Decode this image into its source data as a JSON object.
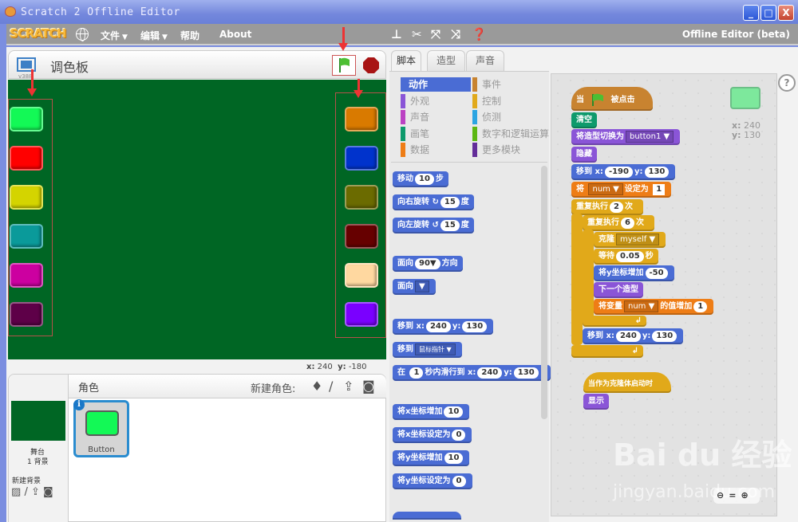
{
  "window": {
    "title": "Scratch 2 Offline Editor",
    "minimize": "_",
    "maximize": "□",
    "close": "X"
  },
  "menubar": {
    "logo": "SCRATCH",
    "items": [
      {
        "label": "文件",
        "has_dropdown": true
      },
      {
        "label": "编辑",
        "has_dropdown": true
      },
      {
        "label": "帮助"
      },
      {
        "label": "About"
      }
    ],
    "tool_icons": [
      "duplicate-stamp-icon",
      "cut-scissors-icon",
      "grow-icon",
      "shrink-icon",
      "help-icon"
    ],
    "right_label": "Offline Editor (beta)"
  },
  "stage": {
    "title": "调色板",
    "version": "v388",
    "mouse_x_label": "x:",
    "mouse_x": "240",
    "mouse_y_label": "y:",
    "mouse_y": "-180",
    "left_buttons": [
      "#13f956",
      "#ff0000",
      "#d4d400",
      "#0a9a9a",
      "#cc00a0",
      "#5e0048"
    ],
    "right_buttons": [
      "#d97a00",
      "#0033cc",
      "#6b6b00",
      "#660000",
      "#ffd8a0",
      "#7a00ff"
    ],
    "background": "#006624"
  },
  "sprites": {
    "header": "角色",
    "new_sprite_label": "新建角色:",
    "stage_label": "舞台",
    "backdrop_count": "1 背景",
    "new_backdrop_label": "新建背景",
    "items": [
      {
        "name": "Button",
        "color": "#13f956"
      }
    ]
  },
  "tabs": [
    {
      "label": "脚本",
      "active": true
    },
    {
      "label": "造型"
    },
    {
      "label": "声音"
    }
  ],
  "categories": {
    "left": [
      {
        "label": "动作",
        "color": "#4a6cd4",
        "selected": true
      },
      {
        "label": "外观",
        "color": "#8a55d7"
      },
      {
        "label": "声音",
        "color": "#bb42c3"
      },
      {
        "label": "画笔",
        "color": "#0e9a6c"
      },
      {
        "label": "数据",
        "color": "#ee7d16"
      }
    ],
    "right": [
      {
        "label": "事件",
        "color": "#c88330"
      },
      {
        "label": "控制",
        "color": "#e1a91a"
      },
      {
        "label": "侦测",
        "color": "#2ca5e2"
      },
      {
        "label": "数字和逻辑运算",
        "color": "#5cb712"
      },
      {
        "label": "更多模块",
        "color": "#632d99"
      }
    ]
  },
  "palette_blocks": {
    "move": {
      "a": "移动",
      "v": "10",
      "b": "步"
    },
    "turn_right": {
      "a": "向右旋转",
      "icon": "↻",
      "v": "15",
      "b": "度"
    },
    "turn_left": {
      "a": "向左旋转",
      "icon": "↺",
      "v": "15",
      "b": "度"
    },
    "point_dir": {
      "a": "面向",
      "v": "90▼",
      "b": "方向"
    },
    "point_towards": {
      "a": "面向",
      "v": "▼"
    },
    "goto_xy": {
      "a": "移到",
      "x": "x:",
      "xv": "240",
      "y": "y:",
      "yv": "130"
    },
    "goto": {
      "a": "移到",
      "v": "鼠标指针 ▼"
    },
    "glide": {
      "a": "在",
      "v": "1",
      "b": "秒内滑行到",
      "x": "x:",
      "xv": "240",
      "y": "y:",
      "yv": "130"
    },
    "change_x": {
      "a": "将x坐标增加",
      "v": "10"
    },
    "set_x": {
      "a": "将x坐标设定为",
      "v": "0"
    },
    "change_y": {
      "a": "将y坐标增加",
      "v": "10"
    },
    "set_y": {
      "a": "将y坐标设定为",
      "v": "0"
    }
  },
  "script1": {
    "hat": {
      "a": "当",
      "b": "被点击"
    },
    "clear": "清空",
    "switch_costume": {
      "a": "将造型切换为",
      "v": "button1 ▼"
    },
    "hide": "隐藏",
    "goto_xy": {
      "a": "移到",
      "x": "x:",
      "xv": "-190",
      "y": "y:",
      "yv": "130"
    },
    "set_var": {
      "a": "将",
      "v": "num ▼",
      "b": "设定为",
      "val": "1"
    },
    "repeat_outer": {
      "a": "重复执行",
      "v": "2",
      "b": "次"
    },
    "repeat_inner": {
      "a": "重复执行",
      "v": "6",
      "b": "次"
    },
    "clone": {
      "a": "克隆",
      "v": "myself ▼"
    },
    "wait": {
      "a": "等待",
      "v": "0.05",
      "b": "秒"
    },
    "change_y": {
      "a": "将y坐标增加",
      "v": "-50"
    },
    "next_costume": "下一个造型",
    "change_var": {
      "a": "将变量",
      "v": "num ▼",
      "b": "的值增加",
      "val": "1"
    },
    "goto_xy2": {
      "a": "移到",
      "x": "x:",
      "xv": "240",
      "y": "y:",
      "yv": "130"
    },
    "loop_arrow": "↲"
  },
  "script2": {
    "hat": "当作为克隆体启动时",
    "show": "显示"
  },
  "sprite_info": {
    "x_label": "x:",
    "x": "240",
    "y_label": "y:",
    "y": "130"
  },
  "zoom_controls": {
    "out": "🔍-",
    "reset": "=",
    "in": "🔍+"
  },
  "watermark": {
    "line1": "Bai du 经验",
    "line2": "jingyan.baidu.com"
  }
}
